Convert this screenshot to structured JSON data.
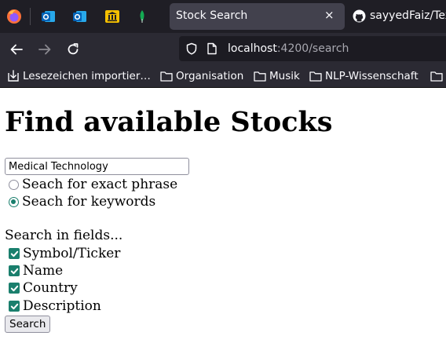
{
  "browser": {
    "pinned_tabs": [
      "firefox-icon",
      "outlook-icon",
      "outlook-icon",
      "bank-icon",
      "mongodb-leaf-icon"
    ],
    "active_tab": {
      "title": "Stock Search",
      "close_label": "×"
    },
    "second_tab": {
      "title": "sayyedFaiz/Tex"
    },
    "url": {
      "host": "localhost",
      "rest": ":4200/search"
    },
    "bookmarks": [
      {
        "label": "Lesezeichen importier…",
        "icon": "import-icon"
      },
      {
        "label": "Organisation",
        "icon": "folder-icon"
      },
      {
        "label": "Musik",
        "icon": "folder-icon"
      },
      {
        "label": "NLP-Wissenschaft",
        "icon": "folder-icon"
      },
      {
        "label": "",
        "icon": "folder-icon"
      }
    ]
  },
  "page": {
    "title": "Find available Stocks",
    "search_value": "Medical Technology",
    "match_options": [
      {
        "label": "Seach for exact phrase",
        "selected": false
      },
      {
        "label": "Seach for keywords",
        "selected": true
      }
    ],
    "fields_label": "Search in fields...",
    "fields": [
      {
        "label": "Symbol/Ticker",
        "checked": true
      },
      {
        "label": "Name",
        "checked": true
      },
      {
        "label": "Country",
        "checked": true
      },
      {
        "label": "Description",
        "checked": true
      }
    ],
    "search_button": "Search"
  },
  "colors": {
    "tabbar_bg": "#1f1e25",
    "toolbar_bg": "#2b2a33",
    "accent_green": "#1a7f6d"
  }
}
